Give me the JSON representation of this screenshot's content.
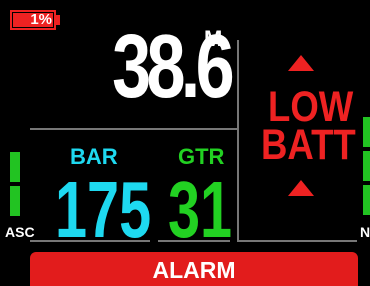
{
  "battery": {
    "level_text": "1%",
    "level_fraction": 0.01
  },
  "depth": {
    "value": "38.6",
    "unit": "M"
  },
  "warning": {
    "line1": "LOW",
    "line2": "BATT"
  },
  "gauges": {
    "bar": {
      "label": "BAR",
      "value": "175",
      "color": "#1ed9f0"
    },
    "gtr": {
      "label": "GTR",
      "value": "31",
      "color": "#22d122"
    }
  },
  "left_indicator": {
    "label": "ASC",
    "segments": 3
  },
  "right_indicator": {
    "label": "N",
    "segments": 3
  },
  "alarm": {
    "label": "ALARM"
  },
  "colors": {
    "warning": "#ee2222",
    "alarm_bg": "#e21c1c",
    "bar": "#1ed9f0",
    "gtr": "#22d122",
    "indicator": "#22c322"
  }
}
